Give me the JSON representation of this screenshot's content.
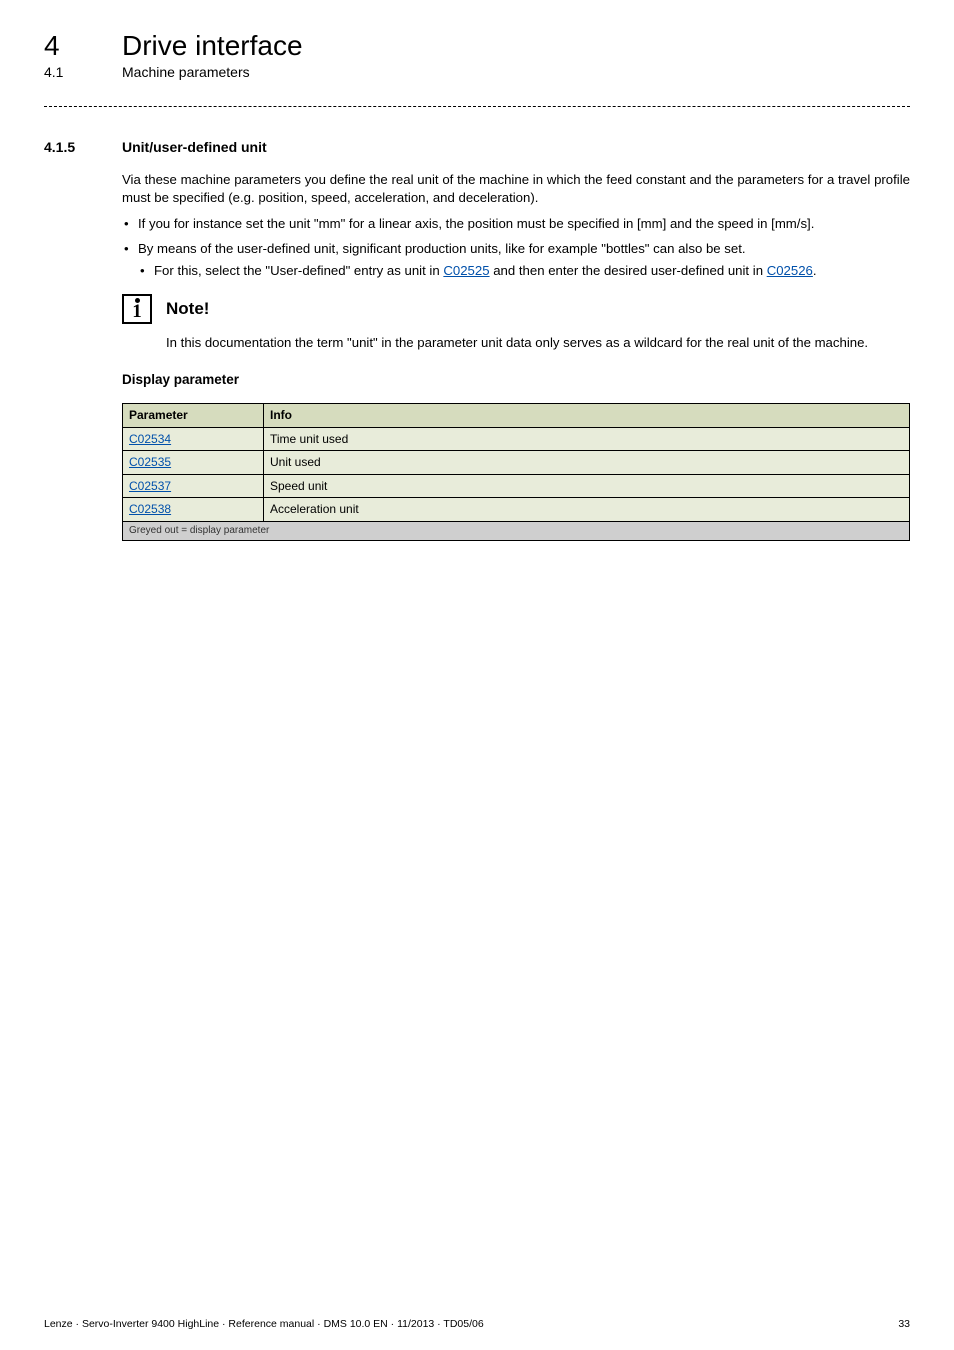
{
  "header": {
    "chapter_number": "4",
    "chapter_title": "Drive interface",
    "subchapter_number": "4.1",
    "subchapter_title": "Machine parameters"
  },
  "section": {
    "number": "4.1.5",
    "title": "Unit/user-defined unit"
  },
  "intro": "Via these machine parameters you define the real unit of the machine in which the feed constant and the parameters for a travel profile must be specified (e.g. position, speed, acceleration, and deceleration).",
  "bullets": [
    {
      "text": "If you for instance set the unit \"mm\" for a linear axis, the position must be specified in [mm] and the speed in [mm/s]."
    },
    {
      "text": "By means of the user-defined unit, significant production units, like for example \"bottles\" can also be set.",
      "sub": {
        "pre": "For this, select the \"User-defined\" entry as unit in ",
        "link1": "C02525",
        "mid": " and then enter the desired user-defined unit in ",
        "link2": "C02526",
        "post": "."
      }
    }
  ],
  "note": {
    "title": "Note!",
    "text": "In this documentation the term \"unit\" in the parameter unit data only serves as a wildcard for the real unit of the machine."
  },
  "display_heading": "Display parameter",
  "table": {
    "headers": {
      "col1": "Parameter",
      "col2": "Info"
    },
    "rows": [
      {
        "param": "C02534",
        "info": "Time unit used"
      },
      {
        "param": "C02535",
        "info": "Unit used"
      },
      {
        "param": "C02537",
        "info": "Speed unit"
      },
      {
        "param": "C02538",
        "info": "Acceleration unit"
      }
    ],
    "footnote": "Greyed out = display parameter"
  },
  "footer": {
    "left": "Lenze · Servo-Inverter 9400 HighLine · Reference manual · DMS 10.0 EN · 11/2013 · TD05/06",
    "page": "33"
  }
}
